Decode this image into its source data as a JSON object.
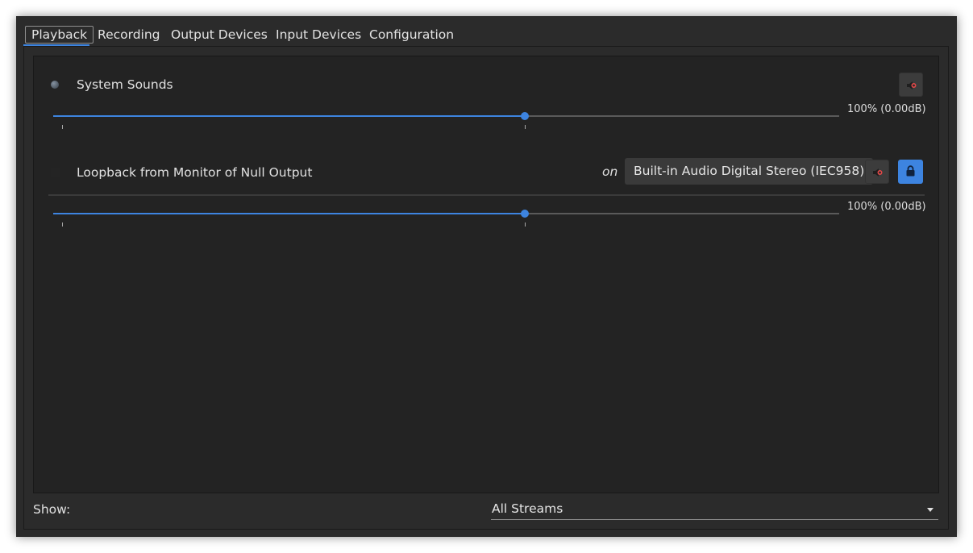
{
  "tabs": [
    {
      "label": "Playback",
      "active": true
    },
    {
      "label": "Recording",
      "active": false
    },
    {
      "label": "Output Devices",
      "active": false
    },
    {
      "label": "Input Devices",
      "active": false
    },
    {
      "label": "Configuration",
      "active": false
    }
  ],
  "streams": [
    {
      "name": "System Sounds",
      "app_icon": "system-sounds-dot-icon",
      "volume_fraction": 0.6,
      "volume_label": "100% (0.00dB)",
      "mute_icon": "speaker-mute-icon"
    },
    {
      "name": "Loopback from Monitor of Null Output",
      "app_icon": "blank-app-icon",
      "on_label": "on",
      "device": "Built-in Audio Digital Stereo (IEC958)",
      "volume_fraction": 0.6,
      "volume_label": "100% (0.00dB)",
      "mute_icon": "speaker-mute-icon",
      "lock_icon": "lock-icon",
      "lock_active": true
    }
  ],
  "footer": {
    "show_label": "Show:",
    "filter_value": "All Streams"
  },
  "colors": {
    "accent": "#3d84e0",
    "window_bg": "#2b2b2b",
    "content_bg": "#232323"
  }
}
